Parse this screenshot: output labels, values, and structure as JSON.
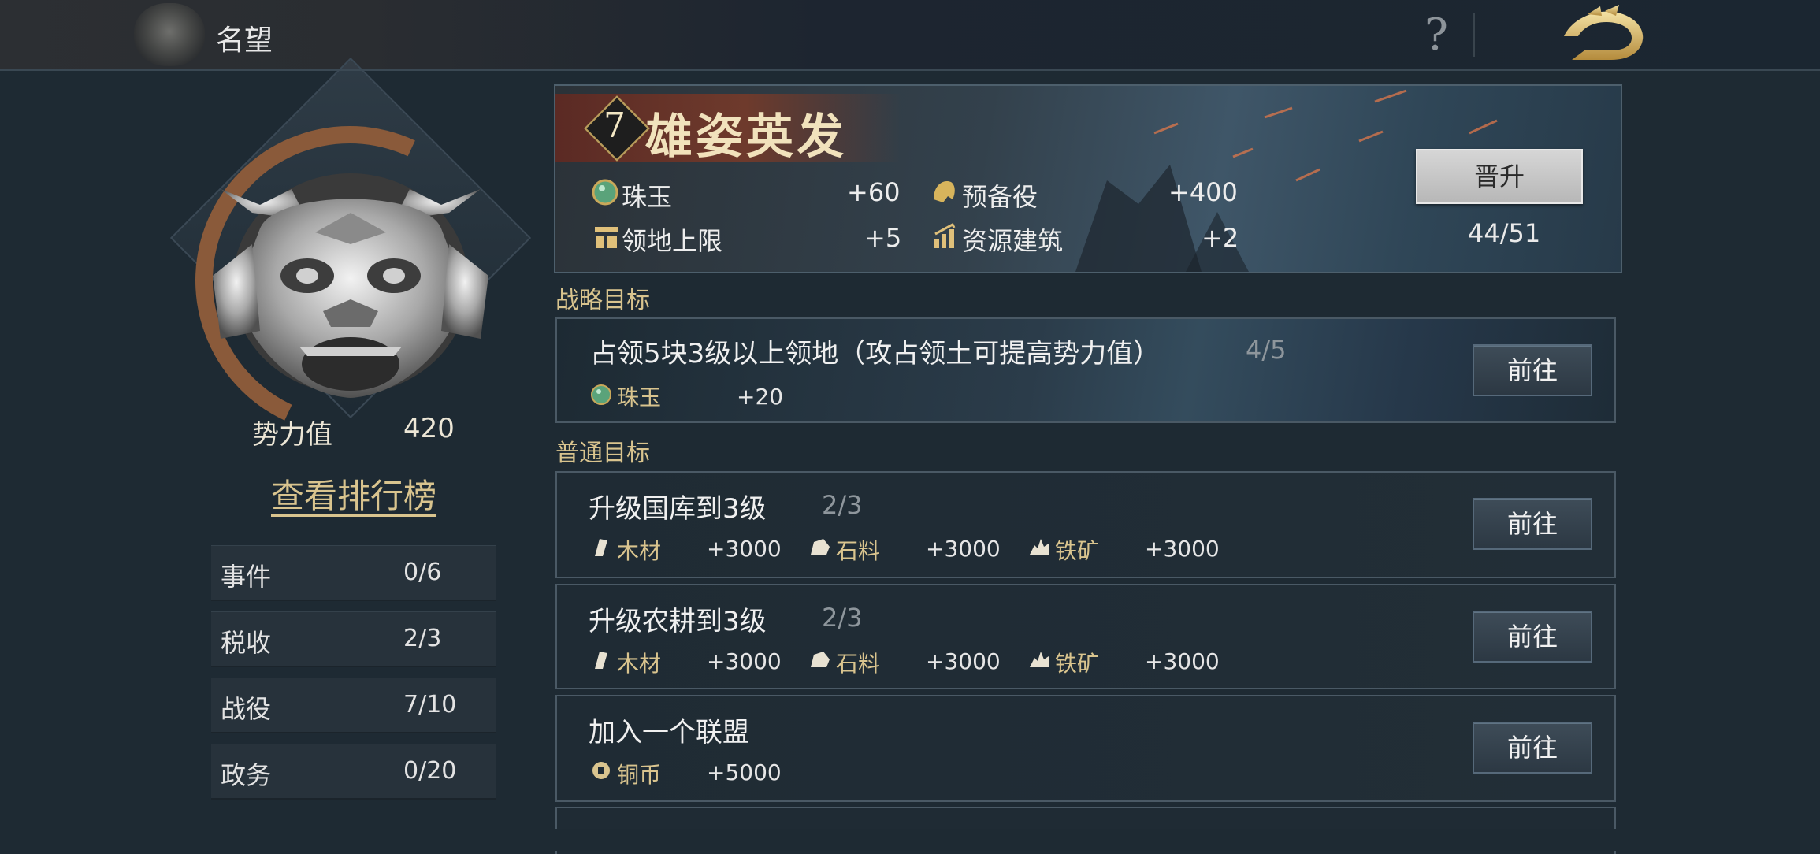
{
  "header": {
    "title": "名望",
    "help_icon": "question-mark-icon",
    "back_icon": "dragon-back-icon"
  },
  "profile": {
    "power_label": "势力值",
    "power_value": "420",
    "rank_link": "查看排行榜",
    "stats": [
      {
        "label": "事件",
        "value": "0/6"
      },
      {
        "label": "税收",
        "value": "2/3"
      },
      {
        "label": "战役",
        "value": "7/10"
      },
      {
        "label": "政务",
        "value": "0/20"
      }
    ]
  },
  "banner": {
    "level": "7",
    "title": "雄姿英发",
    "rewards": [
      {
        "name": "珠玉",
        "value": "+60",
        "icon": "jade-icon"
      },
      {
        "name": "预备役",
        "value": "+400",
        "icon": "helmet-icon"
      },
      {
        "name": "领地上限",
        "value": "+5",
        "icon": "territory-icon"
      },
      {
        "name": "资源建筑",
        "value": "+2",
        "icon": "building-icon"
      }
    ],
    "promote_label": "晋升",
    "promote_progress": "44/51"
  },
  "strategic": {
    "section_title": "战略目标",
    "goal": {
      "title": "占领5块3级以上领地（攻占领土可提高势力值）",
      "progress": "4/5",
      "reward_name": "珠玉",
      "reward_value": "+20",
      "button": "前往"
    }
  },
  "normal": {
    "section_title": "普通目标",
    "goals": [
      {
        "title": "升级国库到3级",
        "progress": "2/3",
        "button": "前往",
        "rewards": [
          {
            "name": "木材",
            "value": "+3000"
          },
          {
            "name": "石料",
            "value": "+3000"
          },
          {
            "name": "铁矿",
            "value": "+3000"
          }
        ]
      },
      {
        "title": "升级农耕到3级",
        "progress": "2/3",
        "button": "前往",
        "rewards": [
          {
            "name": "木材",
            "value": "+3000"
          },
          {
            "name": "石料",
            "value": "+3000"
          },
          {
            "name": "铁矿",
            "value": "+3000"
          }
        ]
      },
      {
        "title": "加入一个联盟",
        "progress": "",
        "button": "前往",
        "rewards": [
          {
            "name": "铜币",
            "value": "+5000"
          }
        ]
      }
    ]
  },
  "colors": {
    "accent_gold": "#d9c48e",
    "panel_bg": "#1e2a33",
    "banner_red": "#6e3a2c"
  }
}
